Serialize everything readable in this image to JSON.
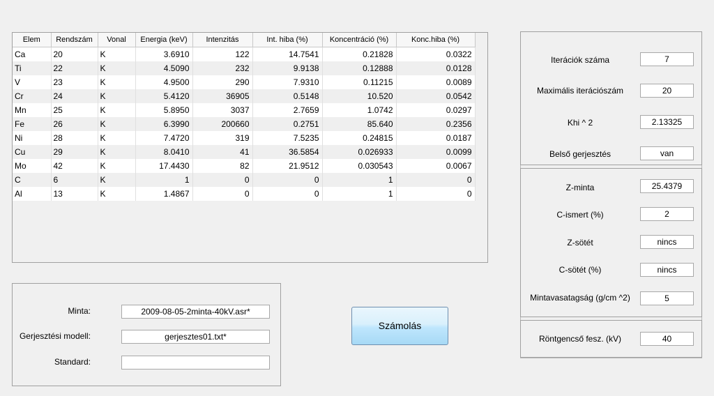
{
  "table": {
    "columns": [
      "Elem",
      "Rendszám",
      "Vonal",
      "Energia (keV)",
      "Intenzitás",
      "Int. hiba (%)",
      "Koncentráció (%)",
      "Konc.hiba (%)"
    ],
    "rows": [
      [
        "Ca",
        "20",
        "K",
        "3.6910",
        "122",
        "14.7541",
        "0.21828",
        "0.0322"
      ],
      [
        "Ti",
        "22",
        "K",
        "4.5090",
        "232",
        "9.9138",
        "0.12888",
        "0.0128"
      ],
      [
        "V",
        "23",
        "K",
        "4.9500",
        "290",
        "7.9310",
        "0.11215",
        "0.0089"
      ],
      [
        "Cr",
        "24",
        "K",
        "5.4120",
        "36905",
        "0.5148",
        "10.520",
        "0.0542"
      ],
      [
        "Mn",
        "25",
        "K",
        "5.8950",
        "3037",
        "2.7659",
        "1.0742",
        "0.0297"
      ],
      [
        "Fe",
        "26",
        "K",
        "6.3990",
        "200660",
        "0.2751",
        "85.640",
        "0.2356"
      ],
      [
        "Ni",
        "28",
        "K",
        "7.4720",
        "319",
        "7.5235",
        "0.24815",
        "0.0187"
      ],
      [
        "Cu",
        "29",
        "K",
        "8.0410",
        "41",
        "36.5854",
        "0.026933",
        "0.0099"
      ],
      [
        "Mo",
        "42",
        "K",
        "17.4430",
        "82",
        "21.9512",
        "0.030543",
        "0.0067"
      ],
      [
        "C",
        "6",
        "K",
        "1",
        "0",
        "0",
        "1",
        "0"
      ],
      [
        "Al",
        "13",
        "K",
        "1.4867",
        "0",
        "0",
        "1",
        "0"
      ]
    ]
  },
  "files": {
    "minta_label": "Minta:",
    "minta_value": "2009-08-05-2minta-40kV.asr*",
    "gerj_label": "Gerjesztési modell:",
    "gerj_value": "gerjesztes01.txt*",
    "standard_label": "Standard:",
    "standard_value": ""
  },
  "calc_button_label": "Számolás",
  "iteration": {
    "iter_count_label": "Iterációk száma",
    "iter_count_value": "7",
    "max_iter_label": "Maximális iterációszám",
    "max_iter_value": "20",
    "khi_label": "Khi ^ 2",
    "khi_value": "2.13325",
    "internal_label": "Belső gerjesztés",
    "internal_value": "van"
  },
  "sample": {
    "z_minta_label": "Z-minta",
    "z_minta_value": "25.4379",
    "c_ismert_label": "C-ismert (%)",
    "c_ismert_value": "2",
    "z_sotet_label": "Z-sötét",
    "z_sotet_value": "nincs",
    "c_sotet_label": "C-sötét (%)",
    "c_sotet_value": "nincs",
    "thickness_label": "Mintavasatagság (g/cm ^2)",
    "thickness_value": "5"
  },
  "tube": {
    "label": "Röntgencső fesz. (kV)",
    "value": "40"
  }
}
